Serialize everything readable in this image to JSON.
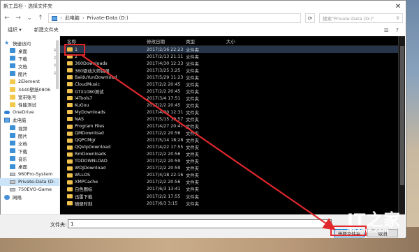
{
  "window": {
    "title": "新工具栏 - 选择文件夹"
  },
  "address": {
    "segments": [
      "此电脑",
      "Private-Data (D:)"
    ],
    "search_placeholder": "搜索\"Private-Data (D:)\""
  },
  "toolbar": {
    "organize": "组织 ▾",
    "new_folder": "新建文件夹"
  },
  "sidebar": {
    "quick_access": "快速访问",
    "items": [
      {
        "label": "桌面",
        "pinned": true
      },
      {
        "label": "下载",
        "pinned": true
      },
      {
        "label": "文档",
        "pinned": true
      },
      {
        "label": "图片",
        "pinned": true
      },
      {
        "label": "2Element",
        "pinned": false
      },
      {
        "label": "3440壁纸0806",
        "pinned": false
      },
      {
        "label": "宽带账号",
        "pinned": false
      },
      {
        "label": "性能测试",
        "pinned": false
      }
    ],
    "onedrive": "OneDrive",
    "this_pc": "此电脑",
    "pc_items": [
      "视频",
      "图片",
      "文档",
      "下载",
      "音乐",
      "桌面"
    ],
    "drives": [
      "960Pro-System",
      "Private-Data (D:",
      "750EVO-Game"
    ],
    "network": "网络"
  },
  "columns": {
    "name": "名称",
    "date": "修改日期",
    "type": "类型",
    "size": "大小"
  },
  "files": [
    {
      "name": "1",
      "date": "2017/2/16 22:23",
      "type": "文件夹"
    },
    {
      "name": "2",
      "date": "2017/2/13 21:11",
      "type": "文件夹"
    },
    {
      "name": "360Downloads",
      "date": "2017/4/30 12:33",
      "type": "文件夹"
    },
    {
      "name": "360驱动大师目录",
      "date": "2017/3/25 3:25",
      "type": "文件夹"
    },
    {
      "name": "BaiduYunDownload",
      "date": "2017/5/29 11:23",
      "type": "文件夹"
    },
    {
      "name": "CloudMusic",
      "date": "2017/2/2 20:45",
      "type": "文件夹"
    },
    {
      "name": "GTX1080测试",
      "date": "2017/2/2 20:45",
      "type": "文件夹"
    },
    {
      "name": "i4Tools7",
      "date": "2017/3/4 17:51",
      "type": "文件夹"
    },
    {
      "name": "KuGou",
      "date": "2017/2/2 20:45",
      "type": "文件夹"
    },
    {
      "name": "MyDownloads",
      "date": "2017/4/30 12:31",
      "type": "文件夹"
    },
    {
      "name": "NAS",
      "date": "2017/5/15 19:57",
      "type": "文件夹"
    },
    {
      "name": "Program Files",
      "date": "2017/4/27 20:47",
      "type": "文件夹"
    },
    {
      "name": "QMDownload",
      "date": "2017/2/2 20:56",
      "type": "文件夹"
    },
    {
      "name": "QQPCMgr",
      "date": "2017/5/14 18:28",
      "type": "文件夹"
    },
    {
      "name": "QQVipDownload",
      "date": "2017/4/22 17:55",
      "type": "文件夹"
    },
    {
      "name": "RmDownloads",
      "date": "2017/2/2 20:56",
      "type": "文件夹"
    },
    {
      "name": "TDDOWNLOAD",
      "date": "2017/2/2 20:59",
      "type": "文件夹"
    },
    {
      "name": "WDJDownload",
      "date": "2017/2/2 20:59",
      "type": "文件夹"
    },
    {
      "name": "WLLOS",
      "date": "2017/4/18 22:16",
      "type": "文件夹"
    },
    {
      "name": "XMPCache",
      "date": "2017/2/2 20:56",
      "type": "文件夹"
    },
    {
      "name": "白色图标",
      "date": "2017/6/3 13:41",
      "type": "文件夹"
    },
    {
      "name": "迅雷下载",
      "date": "2017/2/2 17:55",
      "type": "文件夹"
    },
    {
      "name": "随便时刻",
      "date": "2017/6/3 3:15",
      "type": "文件夹"
    }
  ],
  "footer": {
    "label": "文件夹:",
    "value": "1",
    "ok": "选择文件夹",
    "cancel": "取消"
  },
  "watermark": {
    "logo": "IT之家",
    "site": "ithome.com"
  },
  "colors": {
    "highlight": "#e0282c",
    "folder": "#f0c14b",
    "selection": "#cce4f7"
  }
}
